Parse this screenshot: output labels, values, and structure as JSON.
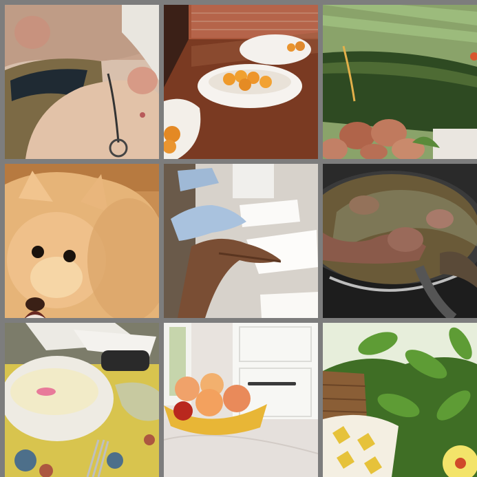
{
  "grid": {
    "rows": 3,
    "columns": 3,
    "background": "#7d7d7d"
  },
  "tiles": [
    {
      "subject": "person-with-glasses",
      "dominant_color": "#c9a58c"
    },
    {
      "subject": "bowls-of-cherry-tomatoes-on-table",
      "dominant_color": "#7a3a22"
    },
    {
      "subject": "zucchini-and-potatoes",
      "dominant_color": "#4f6a2e"
    },
    {
      "subject": "pomeranian-dog",
      "dominant_color": "#e0b27a"
    },
    {
      "subject": "gloved-hands-with-papers",
      "dominant_color": "#cfc9c2"
    },
    {
      "subject": "stew-pot",
      "dominant_color": "#5c4a2e"
    },
    {
      "subject": "yogurt-bowl-on-tablecloth",
      "dominant_color": "#d9c85a"
    },
    {
      "subject": "fruit-bowl-on-counter",
      "dominant_color": "#e7e2dd"
    },
    {
      "subject": "garden-chair-and-hibiscus",
      "dominant_color": "#3f6e25"
    }
  ]
}
